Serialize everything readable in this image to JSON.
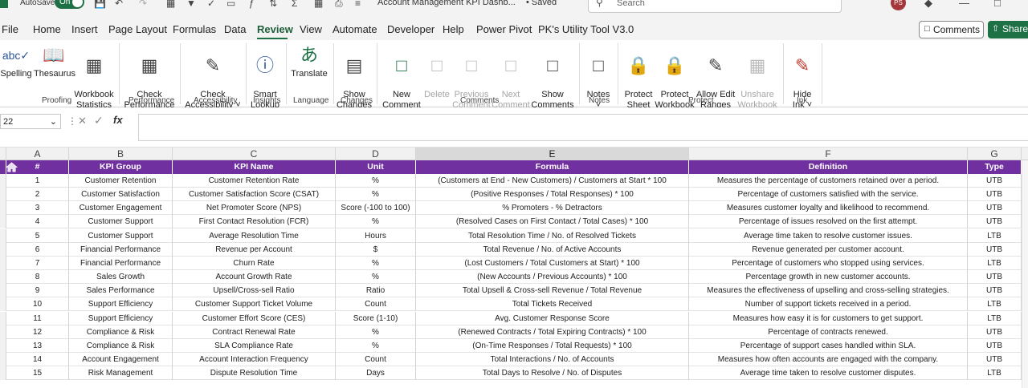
{
  "titlebar": {
    "autosave_label": "AutoSave",
    "autosave_state": "On",
    "doc_title": "Account Management KPI Dashb...",
    "saved_status": "• Saved",
    "search_placeholder": "Search",
    "avatar_initials": "PS"
  },
  "menu": {
    "items": [
      "File",
      "Home",
      "Insert",
      "Page Layout",
      "Formulas",
      "Data",
      "Review",
      "View",
      "Automate",
      "Developer",
      "Help",
      "Power Pivot",
      "PK's Utility Tool V3.0"
    ],
    "active": "Review",
    "comments_button": "Comments",
    "share_button": "Share"
  },
  "ribbon": {
    "buttons": [
      {
        "label": "Spelling",
        "icon": "spelling-icon"
      },
      {
        "label": "Thesaurus",
        "icon": "thesaurus-icon"
      },
      {
        "label": "Workbook\nStatistics",
        "icon": "workbook-statistics-icon"
      },
      {
        "label": "Check\nPerformance",
        "icon": "check-performance-icon"
      },
      {
        "label": "Check\nAccessibility ˅",
        "icon": "check-accessibility-icon"
      },
      {
        "label": "Smart\nLookup",
        "icon": "smart-lookup-icon"
      },
      {
        "label": "Translate",
        "icon": "translate-icon"
      },
      {
        "label": "Show\nChanges",
        "icon": "show-changes-icon"
      },
      {
        "label": "New\nComment",
        "icon": "new-comment-icon"
      },
      {
        "label": "Delete",
        "icon": "delete-comment-icon"
      },
      {
        "label": "Previous\nComment",
        "icon": "previous-comment-icon"
      },
      {
        "label": "Next\nComment",
        "icon": "next-comment-icon"
      },
      {
        "label": "Show\nComments",
        "icon": "show-comments-icon"
      },
      {
        "label": "Notes\n˅",
        "icon": "notes-icon"
      },
      {
        "label": "Protect\nSheet",
        "icon": "protect-sheet-icon"
      },
      {
        "label": "Protect\nWorkbook",
        "icon": "protect-workbook-icon"
      },
      {
        "label": "Allow Edit\nRanges",
        "icon": "allow-edit-ranges-icon"
      },
      {
        "label": "Unshare\nWorkbook",
        "icon": "unshare-workbook-icon"
      },
      {
        "label": "Hide\nInk ˅",
        "icon": "hide-ink-icon"
      }
    ],
    "groups": [
      "Proofing",
      "Performance",
      "Accessibility",
      "Insights",
      "Language",
      "Changes",
      "Comments",
      "Notes",
      "Protect",
      "Ink"
    ]
  },
  "formula_bar": {
    "name_box": "22",
    "fx": "fx",
    "formula": ""
  },
  "columns": [
    "A",
    "B",
    "C",
    "D",
    "E",
    "F",
    "G"
  ],
  "selected_column": "E",
  "table": {
    "headers": [
      "#",
      "KPI Group",
      "KPI Name",
      "Unit",
      "Formula",
      "Definition",
      "Type"
    ],
    "rows": [
      [
        "1",
        "Customer Retention",
        "Customer Retention Rate",
        "%",
        "(Customers at End - New Customers) / Customers at Start * 100",
        "Measures the percentage of customers retained over a period.",
        "UTB"
      ],
      [
        "2",
        "Customer Satisfaction",
        "Customer Satisfaction Score (CSAT)",
        "%",
        "(Positive Responses / Total Responses) * 100",
        "Percentage of customers satisfied with the service.",
        "UTB"
      ],
      [
        "3",
        "Customer Engagement",
        "Net Promoter Score (NPS)",
        "Score (-100 to 100)",
        "% Promoters - % Detractors",
        "Measures customer loyalty and likelihood to recommend.",
        "UTB"
      ],
      [
        "4",
        "Customer Support",
        "First Contact Resolution (FCR)",
        "%",
        "(Resolved Cases on First Contact / Total Cases) * 100",
        "Percentage of issues resolved on the first attempt.",
        "UTB"
      ],
      [
        "5",
        "Customer Support",
        "Average Resolution Time",
        "Hours",
        "Total Resolution Time / No. of Resolved Tickets",
        "Average time taken to resolve customer issues.",
        "LTB"
      ],
      [
        "6",
        "Financial Performance",
        "Revenue per Account",
        "$",
        "Total Revenue / No. of Active Accounts",
        "Revenue generated per customer account.",
        "UTB"
      ],
      [
        "7",
        "Financial Performance",
        "Churn Rate",
        "%",
        "(Lost Customers / Total Customers at Start) * 100",
        "Percentage of customers who stopped using services.",
        "LTB"
      ],
      [
        "8",
        "Sales Growth",
        "Account Growth Rate",
        "%",
        "(New Accounts / Previous Accounts) * 100",
        "Percentage growth in new customer accounts.",
        "UTB"
      ],
      [
        "9",
        "Sales Performance",
        "Upsell/Cross-sell Ratio",
        "Ratio",
        "Total Upsell & Cross-sell Revenue / Total Revenue",
        "Measures the effectiveness of upselling and cross-selling strategies.",
        "UTB"
      ],
      [
        "10",
        "Support Efficiency",
        "Customer Support Ticket Volume",
        "Count",
        "Total Tickets Received",
        "Number of support tickets received in a period.",
        "LTB"
      ],
      [
        "11",
        "Support Efficiency",
        "Customer Effort Score (CES)",
        "Score (1-10)",
        "Avg. Customer Response Score",
        "Measures how easy it is for customers to get support.",
        "LTB"
      ],
      [
        "12",
        "Compliance & Risk",
        "Contract Renewal Rate",
        "%",
        "(Renewed Contracts / Total Expiring Contracts) * 100",
        "Percentage of contracts renewed.",
        "UTB"
      ],
      [
        "13",
        "Compliance & Risk",
        "SLA Compliance Rate",
        "%",
        "(On-Time Responses / Total Requests) * 100",
        "Percentage of support cases handled within SLA.",
        "UTB"
      ],
      [
        "14",
        "Account Engagement",
        "Account Interaction Frequency",
        "Count",
        "Total Interactions / No. of Accounts",
        "Measures how often accounts are engaged with the company.",
        "UTB"
      ],
      [
        "15",
        "Risk Management",
        "Dispute Resolution Time",
        "Days",
        "Total Days to Resolve / No. of Disputes",
        "Average time taken to resolve customer disputes.",
        "LTB"
      ]
    ]
  },
  "colors": {
    "header_purple": "#7030a0",
    "excel_green": "#1e7145",
    "avatar_red": "#a4373a"
  }
}
